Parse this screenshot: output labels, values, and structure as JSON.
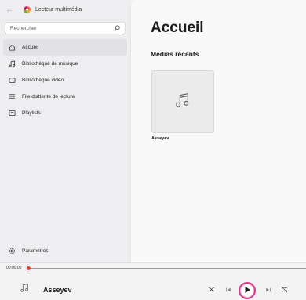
{
  "app": {
    "title": "Lecteur multimédia",
    "back_icon": "back-arrow-icon"
  },
  "search": {
    "placeholder": "Rechercher"
  },
  "nav": {
    "items": [
      {
        "label": "Accueil",
        "icon": "home-icon",
        "active": true
      },
      {
        "label": "Bibliothèque de musique",
        "icon": "music-note-icon"
      },
      {
        "label": "Bibliothèque vidéo",
        "icon": "video-icon"
      },
      {
        "label": "File d'attente de lecture",
        "icon": "queue-icon"
      },
      {
        "label": "Playlists",
        "icon": "playlist-icon"
      }
    ],
    "settings": {
      "label": "Paramètres",
      "icon": "gear-icon"
    }
  },
  "main": {
    "title": "Accueil",
    "section_title": "Médias récents",
    "recent": [
      {
        "label": "Asseyev",
        "icon": "music-note-icon"
      }
    ]
  },
  "player": {
    "time": "00:00:00",
    "track_title": "Asseyev",
    "progress": 0,
    "accent": "#e33b2e"
  }
}
